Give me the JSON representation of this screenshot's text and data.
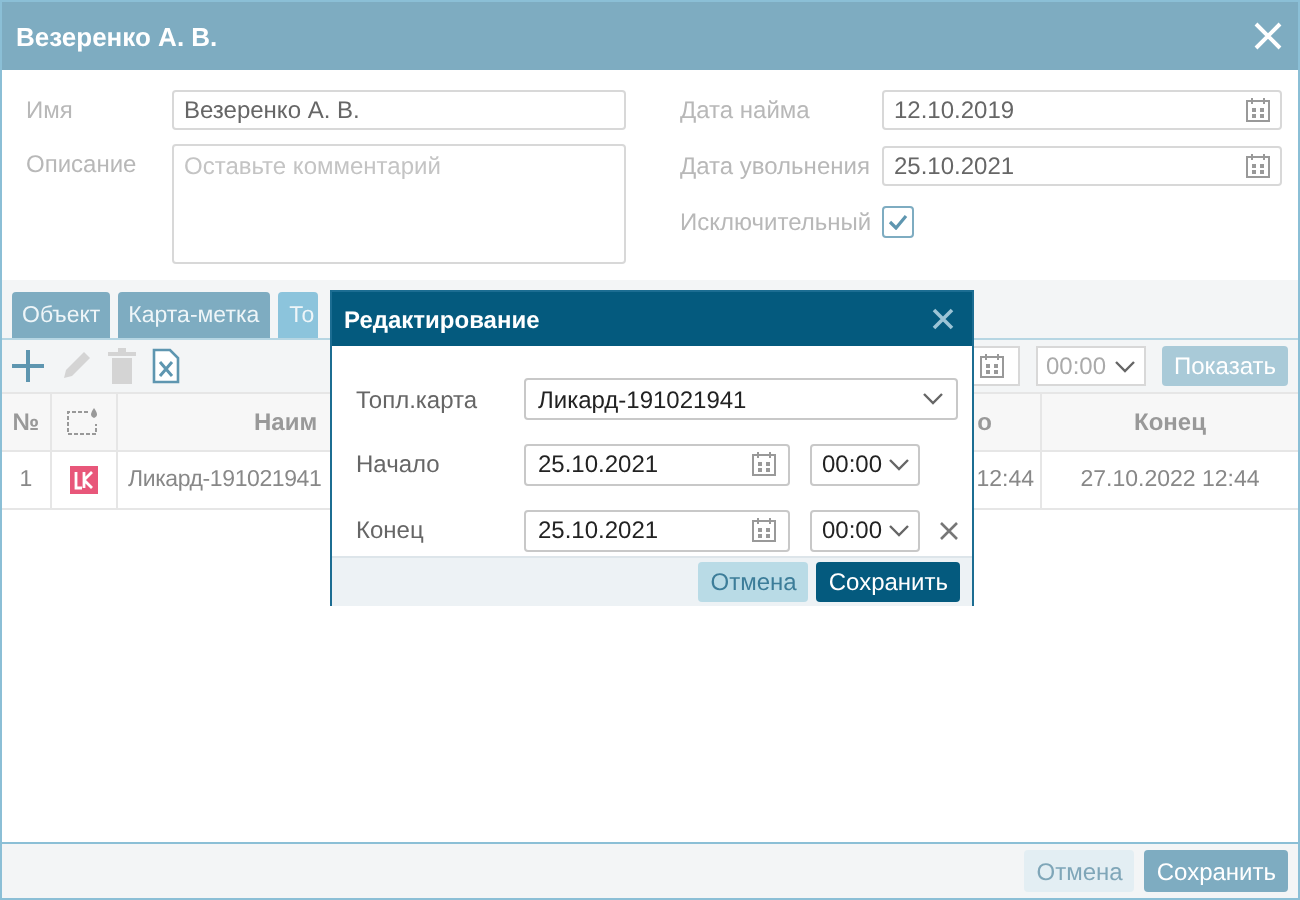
{
  "window": {
    "title": "Везеренко А. В."
  },
  "form": {
    "name": {
      "label": "Имя",
      "value": "Везеренко А. В."
    },
    "description": {
      "label": "Описание",
      "placeholder": "Оставьте комментарий"
    },
    "hire_date": {
      "label": "Дата найма",
      "value": "12.10.2019"
    },
    "dismissal_date": {
      "label": "Дата увольнения",
      "value": "25.10.2021"
    },
    "exceptional": {
      "label": "Исключительный",
      "checked": true
    }
  },
  "tabs": [
    {
      "label": "Объект",
      "selected": false
    },
    {
      "label": "Карта-метка",
      "selected": false
    },
    {
      "label": "То",
      "selected": true
    }
  ],
  "toolbar": {
    "actions": [
      {
        "kind": "add",
        "disabled": false
      },
      {
        "kind": "edit",
        "disabled": true
      },
      {
        "kind": "delete",
        "disabled": true
      },
      {
        "kind": "excel",
        "disabled": false
      }
    ],
    "time": "00:00",
    "show_button": {
      "label": "Показать",
      "disabled": true
    }
  },
  "table": {
    "columns": [
      {
        "kind": "text",
        "label": "№"
      },
      {
        "kind": "icon"
      },
      {
        "kind": "text",
        "label": "Наим"
      },
      {
        "kind": "text",
        "label": "о"
      },
      {
        "kind": "text",
        "label": "Конец"
      }
    ],
    "rows": [
      {
        "number": "1",
        "name": "Ликард-191021941",
        "start": "12:44",
        "end": "27.10.2022 12:44"
      }
    ]
  },
  "footer": {
    "buttons": [
      {
        "label": "Отмена",
        "disabled": true
      },
      {
        "label": "Сохранить",
        "disabled": false
      }
    ]
  },
  "dialog": {
    "title": "Редактирование",
    "card": {
      "label": "Топл.карта",
      "value": "Ликард-191021941"
    },
    "start": {
      "label": "Начало",
      "date": "25.10.2021",
      "time": "00:00",
      "clearable": false
    },
    "end": {
      "label": "Конец",
      "date": "25.10.2021",
      "time": "00:00",
      "clearable": true
    },
    "buttons": [
      {
        "label": "Отмена",
        "kind": "secondary"
      },
      {
        "label": "Сохранить",
        "kind": "primary"
      }
    ]
  }
}
